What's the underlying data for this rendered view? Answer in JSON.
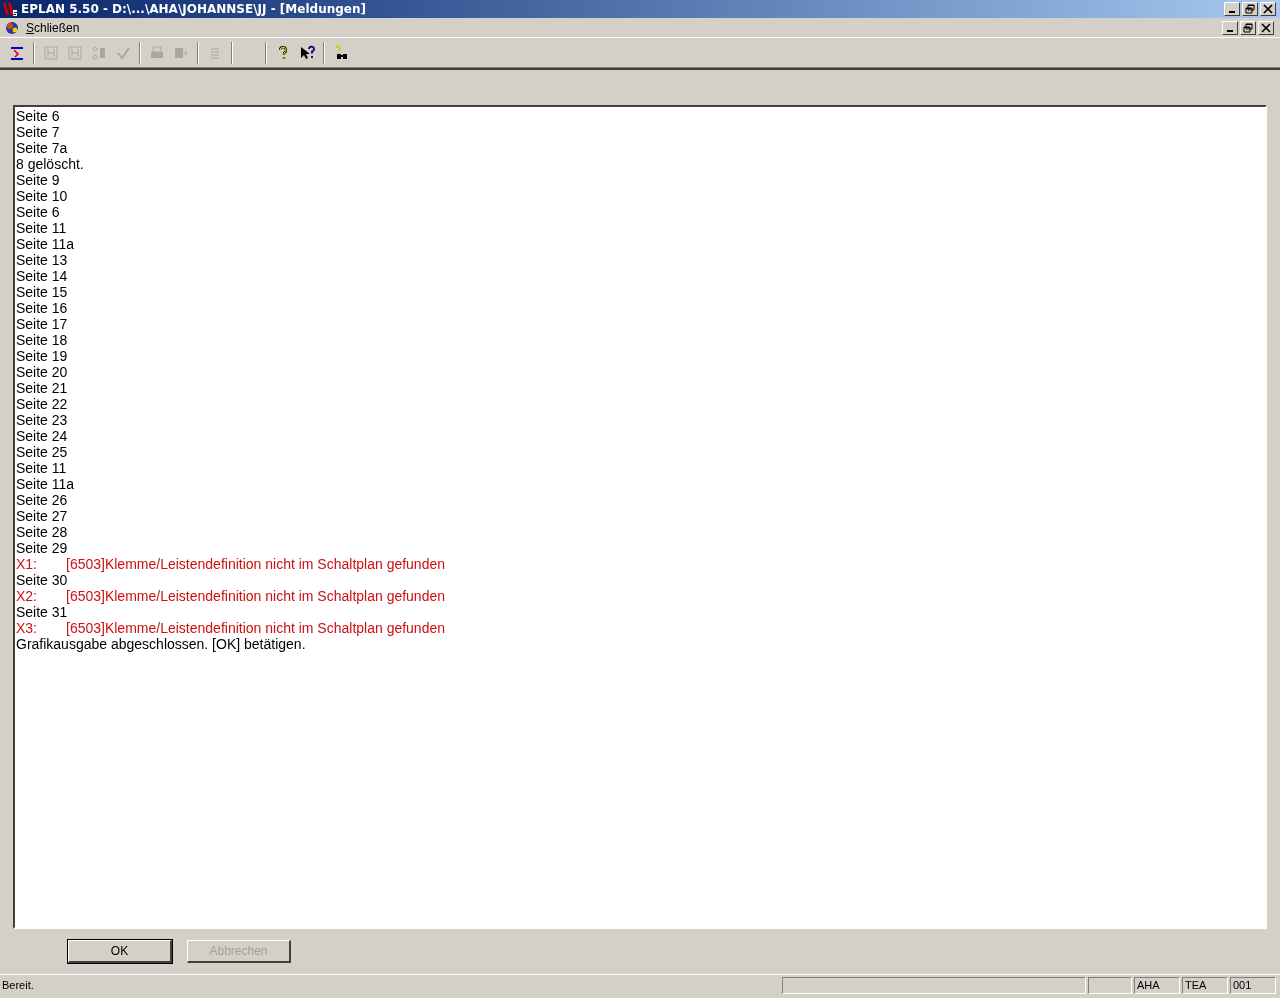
{
  "window": {
    "title": "EPLAN 5.50 - D:\\...\\AHA\\JOHANNSE\\JJ - [Meldungen]"
  },
  "menu": [
    {
      "label": "Schließen"
    }
  ],
  "toolbar": [
    {
      "kind": "component",
      "disabled": false
    },
    {
      "kind": "sep"
    },
    {
      "kind": "grid",
      "disabled": true
    },
    {
      "kind": "grid",
      "disabled": true
    },
    {
      "kind": "switch",
      "disabled": true
    },
    {
      "kind": "check",
      "disabled": true
    },
    {
      "kind": "sep"
    },
    {
      "kind": "print",
      "disabled": true
    },
    {
      "kind": "export",
      "disabled": true
    },
    {
      "kind": "sep"
    },
    {
      "kind": "lines",
      "disabled": true
    },
    {
      "kind": "sep"
    },
    {
      "kind": "blank"
    },
    {
      "kind": "sep"
    },
    {
      "kind": "help",
      "disabled": false
    },
    {
      "kind": "pointer-help",
      "disabled": false
    },
    {
      "kind": "sep"
    },
    {
      "kind": "find",
      "disabled": false
    }
  ],
  "messages": [
    {
      "kind": "info",
      "text": "Seite 6"
    },
    {
      "kind": "info",
      "text": "Seite 7"
    },
    {
      "kind": "info",
      "text": "Seite 7a"
    },
    {
      "kind": "info",
      "text": "8 gelöscht."
    },
    {
      "kind": "info",
      "text": "Seite 9"
    },
    {
      "kind": "info",
      "text": "Seite 10"
    },
    {
      "kind": "info",
      "text": "Seite 6"
    },
    {
      "kind": "info",
      "text": "Seite 11"
    },
    {
      "kind": "info",
      "text": "Seite 11a"
    },
    {
      "kind": "info",
      "text": "Seite 13"
    },
    {
      "kind": "info",
      "text": "Seite 14"
    },
    {
      "kind": "info",
      "text": "Seite 15"
    },
    {
      "kind": "info",
      "text": "Seite 16"
    },
    {
      "kind": "info",
      "text": "Seite 17"
    },
    {
      "kind": "info",
      "text": "Seite 18"
    },
    {
      "kind": "info",
      "text": "Seite 19"
    },
    {
      "kind": "info",
      "text": "Seite 20"
    },
    {
      "kind": "info",
      "text": "Seite 21"
    },
    {
      "kind": "info",
      "text": "Seite 22"
    },
    {
      "kind": "info",
      "text": "Seite 23"
    },
    {
      "kind": "info",
      "text": "Seite 24"
    },
    {
      "kind": "info",
      "text": "Seite 25"
    },
    {
      "kind": "info",
      "text": "Seite 11"
    },
    {
      "kind": "info",
      "text": "Seite 11a"
    },
    {
      "kind": "info",
      "text": "Seite 26"
    },
    {
      "kind": "info",
      "text": "Seite 27"
    },
    {
      "kind": "info",
      "text": "Seite 28"
    },
    {
      "kind": "info",
      "text": "Seite 29"
    },
    {
      "kind": "error",
      "source": "X1:",
      "text": "[6503]Klemme/Leistendefinition nicht im Schaltplan gefunden"
    },
    {
      "kind": "info",
      "text": "Seite 30"
    },
    {
      "kind": "error",
      "source": "X2:",
      "text": "[6503]Klemme/Leistendefinition nicht im Schaltplan gefunden"
    },
    {
      "kind": "info",
      "text": "Seite 31"
    },
    {
      "kind": "error",
      "source": "X3:",
      "text": "[6503]Klemme/Leistendefinition nicht im Schaltplan gefunden"
    },
    {
      "kind": "info",
      "text": "Grafikausgabe abgeschlossen. [OK] betätigen."
    }
  ],
  "buttons": [
    {
      "label": "OK",
      "default": true,
      "disabled": false
    },
    {
      "label": "Abbrechen",
      "default": false,
      "disabled": true
    }
  ],
  "status_bar": {
    "message": "Bereit.",
    "fields": [
      "AHA",
      "TEA",
      "001"
    ]
  }
}
